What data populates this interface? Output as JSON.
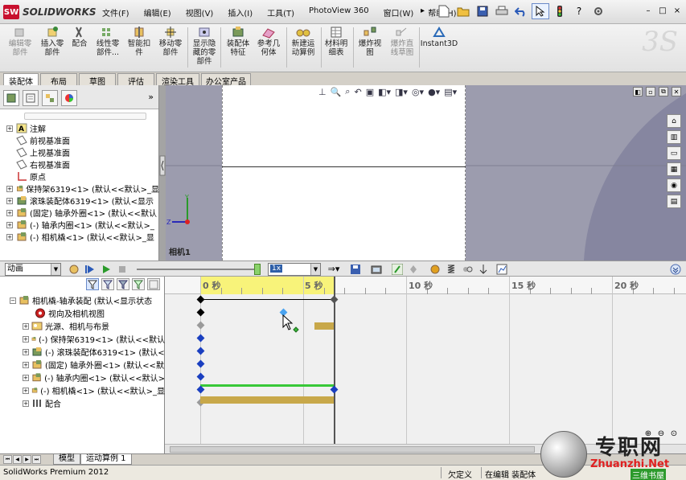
{
  "app": {
    "logo_text": "SOLIDWORKS",
    "logo_badge": "SW",
    "menus": [
      "文件(F)",
      "编辑(E)",
      "视图(V)",
      "插入(I)",
      "工具(T)",
      "PhotoView 360",
      "窗口(W)",
      "帮助(H)"
    ],
    "menu_more": "▸",
    "quick_access_icons": [
      "new-document-icon",
      "open-icon",
      "save-icon",
      "print-icon",
      "undo-icon",
      "select-icon",
      "rebuild-icon",
      "file-properties-icon",
      "options-icon"
    ],
    "window_controls": [
      "?",
      "–",
      "□",
      "×"
    ]
  },
  "ribbon": {
    "buttons": [
      {
        "label": "编辑零\n部件",
        "disabled": true
      },
      {
        "label": "插入零\n部件",
        "disabled": false
      },
      {
        "label": "配合",
        "disabled": false
      },
      {
        "label": "线性零\n部件...",
        "disabled": false
      },
      {
        "label": "智能扣\n件",
        "disabled": false
      },
      {
        "label": "移动零\n部件",
        "disabled": false
      },
      {
        "label": "显示隐\n藏的零\n部件",
        "disabled": false
      },
      {
        "label": "装配体\n特征",
        "disabled": false
      },
      {
        "label": "参考几\n何体",
        "disabled": false
      },
      {
        "label": "新建运\n动算例",
        "disabled": false
      },
      {
        "label": "材料明\n细表",
        "disabled": false
      },
      {
        "label": "爆炸视\n图",
        "disabled": false
      },
      {
        "label": "爆炸直\n线草图",
        "disabled": true
      },
      {
        "label": "Instant3D",
        "disabled": false
      }
    ],
    "watermark": "3S"
  },
  "cmd_tabs": [
    "装配体",
    "布局",
    "草图",
    "评估",
    "渲染工具",
    "办公室产品"
  ],
  "feature_tree": {
    "more": "»",
    "items": [
      {
        "label": "注解",
        "expand": "+"
      },
      {
        "label": "前视基准面",
        "expand": ""
      },
      {
        "label": "上视基准面",
        "expand": ""
      },
      {
        "label": "右视基准面",
        "expand": ""
      },
      {
        "label": "原点",
        "expand": ""
      },
      {
        "label": "保持架6319<1> (默认<<默认>_显",
        "expand": "+"
      },
      {
        "label": "滚珠装配体6319<1> (默认<显示",
        "expand": "+"
      },
      {
        "label": "(固定) 轴承外圈<1> (默认<<默认",
        "expand": "+"
      },
      {
        "label": "(-) 轴承内圈<1> (默认<<默认>_",
        "expand": "+"
      },
      {
        "label": "(-) 相机橇<1> (默认<<默认>_显",
        "expand": "+"
      }
    ]
  },
  "graphics": {
    "camera_label": "相机1",
    "axis_y": "Y",
    "axis_z": "Z",
    "window_buttons": [
      "◧",
      "▫",
      "⧉",
      "✕"
    ]
  },
  "motion_toolbar": {
    "study_type": "动画",
    "speed": "1x",
    "time_slider_fraction": 0.96
  },
  "motion_tree": {
    "items": [
      {
        "label": "相机橇-轴承装配 (默认<显示状态",
        "expand": "−",
        "indent": 0
      },
      {
        "label": "视向及相机视图",
        "expand": "",
        "indent": 1
      },
      {
        "label": "光源、相机与布景",
        "expand": "+",
        "indent": 1
      },
      {
        "label": "(-) 保持架6319<1> (默认<<默认",
        "expand": "+",
        "indent": 1
      },
      {
        "label": "(-) 滚珠装配体6319<1> (默认<",
        "expand": "+",
        "indent": 1
      },
      {
        "label": "(固定) 轴承外圈<1> (默认<<默",
        "expand": "+",
        "indent": 1
      },
      {
        "label": "(-) 轴承内圈<1> (默认<<默认>",
        "expand": "+",
        "indent": 1
      },
      {
        "label": "(-) 相机橇<1> (默认<<默认>_显",
        "expand": "+",
        "indent": 1
      },
      {
        "label": "配合",
        "expand": "+",
        "indent": 1
      }
    ]
  },
  "timeline": {
    "labels": [
      "0 秒",
      "5 秒",
      "10 秒",
      "15 秒",
      "20 秒"
    ],
    "end_time_seconds": 6.5,
    "selected_end_seconds": 6.5
  },
  "bottom_tabs": [
    "模型",
    "运动算例 1"
  ],
  "status": {
    "product": "SolidWorks Premium 2012",
    "definition": "欠定义",
    "mode": "在编辑 装配体"
  },
  "watermark": {
    "title": "专职网",
    "site": "Zhuanzhi.Net",
    "sub": "三维书屋"
  },
  "colors": {
    "logo_red": "#c8102e",
    "key_blue": "#1a3fc0",
    "key_light_blue": "#4aa3f0",
    "track_green": "#38c838",
    "bar_gold": "#c8a84a",
    "timeline_yellow": "#f8f37a"
  }
}
